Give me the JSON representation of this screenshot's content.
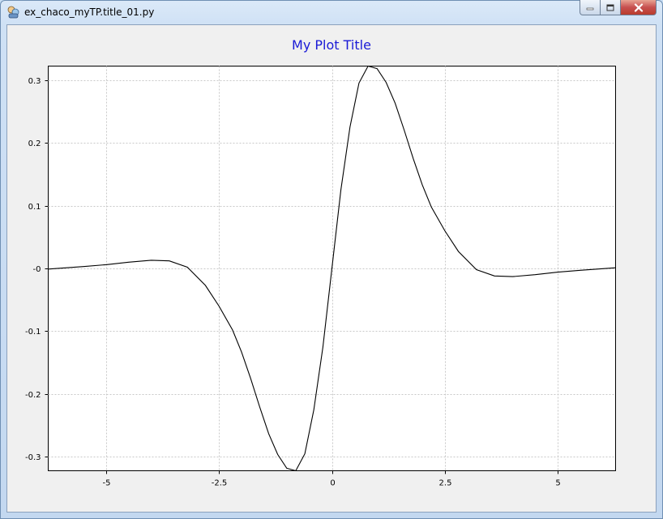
{
  "window": {
    "title": "ex_chaco_myTP.title_01.py",
    "icon": "python-app-icon",
    "buttons": [
      "minimize-icon",
      "maximize-icon",
      "close-icon"
    ]
  },
  "colors": {
    "title": "#1a1ad6",
    "line": "#000000",
    "grid": "#c8c8c8",
    "plot_bg": "#ffffff",
    "window_bg": "#f0f0f0"
  },
  "chart_data": {
    "type": "line",
    "title": "My Plot Title",
    "xlabel": "",
    "ylabel": "",
    "xlim": [
      -6.28,
      6.28
    ],
    "ylim": [
      -0.322,
      0.322
    ],
    "grid": true,
    "x_ticks": [
      -5,
      -2.5,
      0,
      2.5,
      5
    ],
    "x_tick_labels": [
      "-5",
      "-2.5",
      "0",
      "2.5",
      "5"
    ],
    "y_ticks": [
      0.3,
      0.2,
      0.1,
      0,
      -0.1,
      -0.2,
      -0.3
    ],
    "y_tick_labels": [
      "0.3",
      "0.2",
      "0.1",
      "-0",
      "-0.1",
      "-0.2",
      "-0.3"
    ],
    "series": [
      {
        "x": [
          -6.28,
          -5.5,
          -5.0,
          -4.5,
          -4.0,
          -3.6,
          -3.2,
          -2.8,
          -2.5,
          -2.2,
          -2.0,
          -1.8,
          -1.6,
          -1.4,
          -1.2,
          -1.0,
          -0.8,
          -0.6,
          -0.4,
          -0.2,
          0.0,
          0.2,
          0.4,
          0.6,
          0.8,
          1.0,
          1.2,
          1.4,
          1.6,
          1.8,
          2.0,
          2.2,
          2.5,
          2.8,
          3.2,
          3.6,
          4.0,
          4.5,
          5.0,
          5.5,
          6.28
        ],
        "y": [
          -0.001,
          0.003,
          0.006,
          0.01,
          0.013,
          0.012,
          0.002,
          -0.027,
          -0.06,
          -0.098,
          -0.133,
          -0.175,
          -0.22,
          -0.263,
          -0.296,
          -0.318,
          -0.322,
          -0.295,
          -0.225,
          -0.125,
          0.0,
          0.125,
          0.225,
          0.295,
          0.322,
          0.318,
          0.296,
          0.263,
          0.22,
          0.175,
          0.133,
          0.098,
          0.06,
          0.027,
          -0.002,
          -0.012,
          -0.013,
          -0.01,
          -0.006,
          -0.003,
          0.001
        ]
      }
    ]
  }
}
